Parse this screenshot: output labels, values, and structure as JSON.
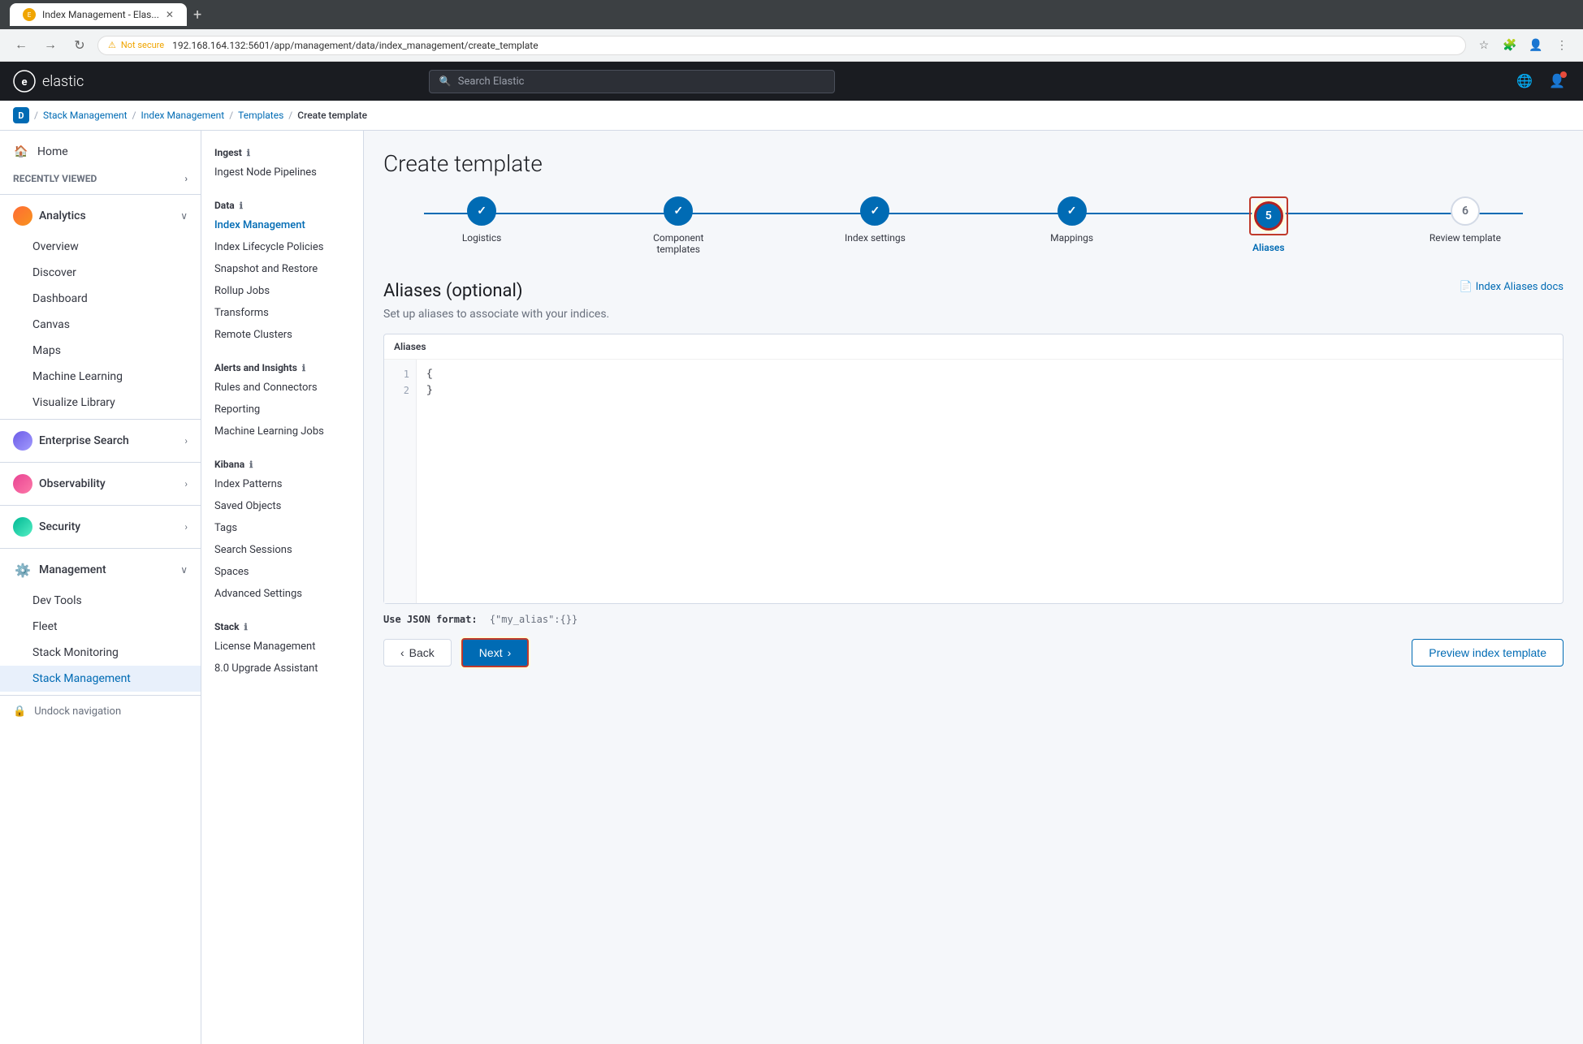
{
  "browser": {
    "tab_title": "Index Management - Elas...",
    "address": "192.168.164.132:5601/app/management/data/index_management/create_template",
    "address_prefix": "Not secure"
  },
  "top_nav": {
    "logo_text": "elastic",
    "search_placeholder": "Search Elastic"
  },
  "breadcrumb": {
    "home_label": "D",
    "items": [
      "Stack Management",
      "Index Management",
      "Templates",
      "Create template"
    ]
  },
  "sidebar": {
    "home_label": "Home",
    "recently_viewed_label": "Recently viewed",
    "categories": [
      {
        "id": "analytics",
        "label": "Analytics",
        "expanded": true
      },
      {
        "id": "enterprise-search",
        "label": "Enterprise Search",
        "expanded": false
      },
      {
        "id": "observability",
        "label": "Observability",
        "expanded": false
      },
      {
        "id": "security",
        "label": "Security",
        "expanded": false
      },
      {
        "id": "management",
        "label": "Management",
        "expanded": true
      }
    ],
    "analytics_items": [
      "Overview",
      "Discover",
      "Dashboard",
      "Canvas",
      "Maps",
      "Machine Learning",
      "Visualize Library"
    ],
    "management_items": [
      "Dev Tools",
      "Fleet",
      "Stack Monitoring",
      "Stack Management"
    ]
  },
  "sub_nav": {
    "sections": [
      {
        "id": "ingest",
        "title": "Ingest",
        "has_info": true,
        "items": [
          "Ingest Node Pipelines"
        ]
      },
      {
        "id": "data",
        "title": "Data",
        "has_info": true,
        "items": [
          "Index Management",
          "Index Lifecycle Policies",
          "Snapshot and Restore",
          "Rollup Jobs",
          "Transforms",
          "Remote Clusters"
        ]
      },
      {
        "id": "alerts-insights",
        "title": "Alerts and Insights",
        "has_info": true,
        "items": [
          "Rules and Connectors",
          "Reporting",
          "Machine Learning Jobs"
        ]
      },
      {
        "id": "kibana",
        "title": "Kibana",
        "has_info": true,
        "items": [
          "Index Patterns",
          "Saved Objects",
          "Tags",
          "Search Sessions",
          "Spaces",
          "Advanced Settings"
        ]
      },
      {
        "id": "stack",
        "title": "Stack",
        "has_info": true,
        "items": [
          "License Management",
          "8.0 Upgrade Assistant"
        ]
      }
    ]
  },
  "page": {
    "title": "Create template",
    "steps": [
      {
        "id": "logistics",
        "label": "Logistics",
        "number": "1",
        "state": "completed"
      },
      {
        "id": "component-templates",
        "label": "Component templates",
        "number": "2",
        "state": "completed"
      },
      {
        "id": "index-settings",
        "label": "Index settings",
        "number": "3",
        "state": "completed"
      },
      {
        "id": "mappings",
        "label": "Mappings",
        "number": "4",
        "state": "completed"
      },
      {
        "id": "aliases",
        "label": "Aliases",
        "number": "5",
        "state": "active"
      },
      {
        "id": "review-template",
        "label": "Review template",
        "number": "6",
        "state": "pending"
      }
    ],
    "section_title": "Aliases (optional)",
    "section_desc": "Set up aliases to associate with your indices.",
    "docs_link": "Index Aliases docs",
    "code_label": "Aliases",
    "code_content": "{\n}",
    "json_hint_label": "Use JSON format:",
    "json_hint_value": "  {\"my_alias\":{}}",
    "back_btn": "Back",
    "next_btn": "Next",
    "preview_btn": "Preview index template"
  }
}
